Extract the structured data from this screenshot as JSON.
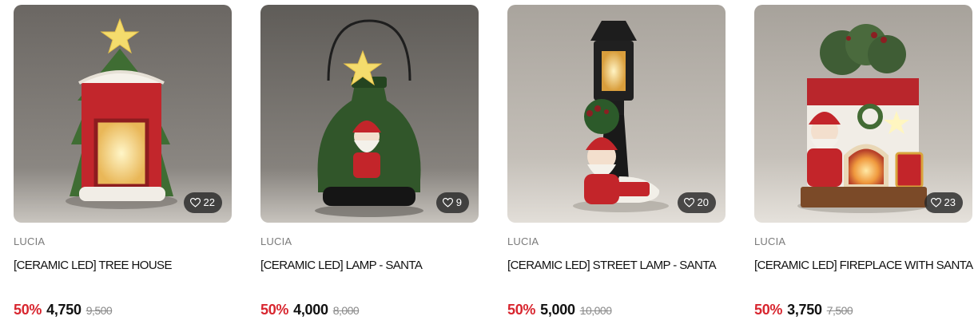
{
  "products": [
    {
      "brand": "LUCIA",
      "title": "[CERAMIC LED] TREE HOUSE",
      "likes": "22",
      "discount": "50%",
      "price": "4,750",
      "original_price": "9,500",
      "image": "ceramic-tree-house"
    },
    {
      "brand": "LUCIA",
      "title": "[CERAMIC LED] LAMP - SANTA",
      "likes": "9",
      "discount": "50%",
      "price": "4,000",
      "original_price": "8,000",
      "image": "ceramic-lantern-santa"
    },
    {
      "brand": "LUCIA",
      "title": "[CERAMIC LED] STREET LAMP - SANTA",
      "likes": "20",
      "discount": "50%",
      "price": "5,000",
      "original_price": "10,000",
      "image": "ceramic-street-lamp-santa"
    },
    {
      "brand": "LUCIA",
      "title": "[CERAMIC LED] FIREPLACE WITH SANTA",
      "likes": "23",
      "discount": "50%",
      "price": "3,750",
      "original_price": "7,500",
      "image": "ceramic-fireplace-santa"
    }
  ],
  "colors": {
    "discount": "#d8262f",
    "badge_bg": "#2b2b2b"
  }
}
